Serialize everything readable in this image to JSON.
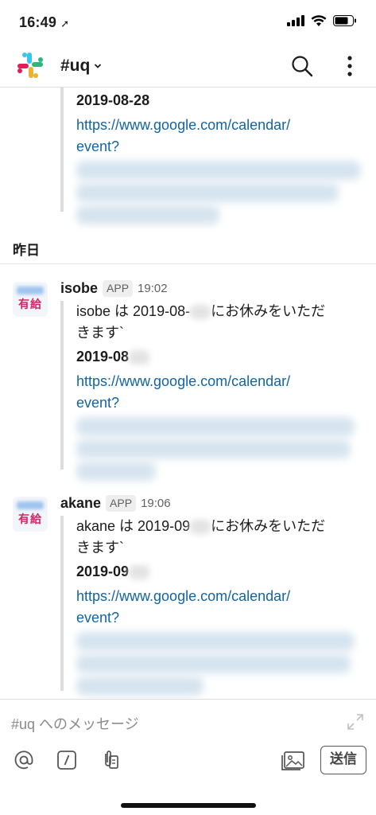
{
  "status_bar": {
    "time": "16:49"
  },
  "header": {
    "channel": "#uq",
    "caret": "⌄"
  },
  "stream": {
    "top_attachment": {
      "date": "2019-08-28",
      "link_lines": [
        "https://www.google.com/calendar/",
        "event?"
      ]
    },
    "day_divider": "昨日",
    "messages": [
      {
        "name": "isobe",
        "badge": "APP",
        "time": "19:02",
        "avatar_text": "有給",
        "text_a": "isobe は 2019-08-",
        "text_b": "にお休みをいただ",
        "text_c": "きます`",
        "date": "2019-08",
        "link_lines": [
          "https://www.google.com/calendar/",
          "event?"
        ]
      },
      {
        "name": "akane",
        "badge": "APP",
        "time": "19:06",
        "avatar_text": "有給",
        "text_a": "akane は 2019-09",
        "text_b": "にお休みをいただ",
        "text_c": "きます`",
        "date": "2019-09",
        "link_lines": [
          "https://www.google.com/calendar/",
          "event?"
        ]
      }
    ]
  },
  "composer": {
    "placeholder": "#uq へのメッセージ",
    "send_label": "送信"
  },
  "colors": {
    "link": "#1264a3",
    "avatar_text": "#d42462"
  }
}
